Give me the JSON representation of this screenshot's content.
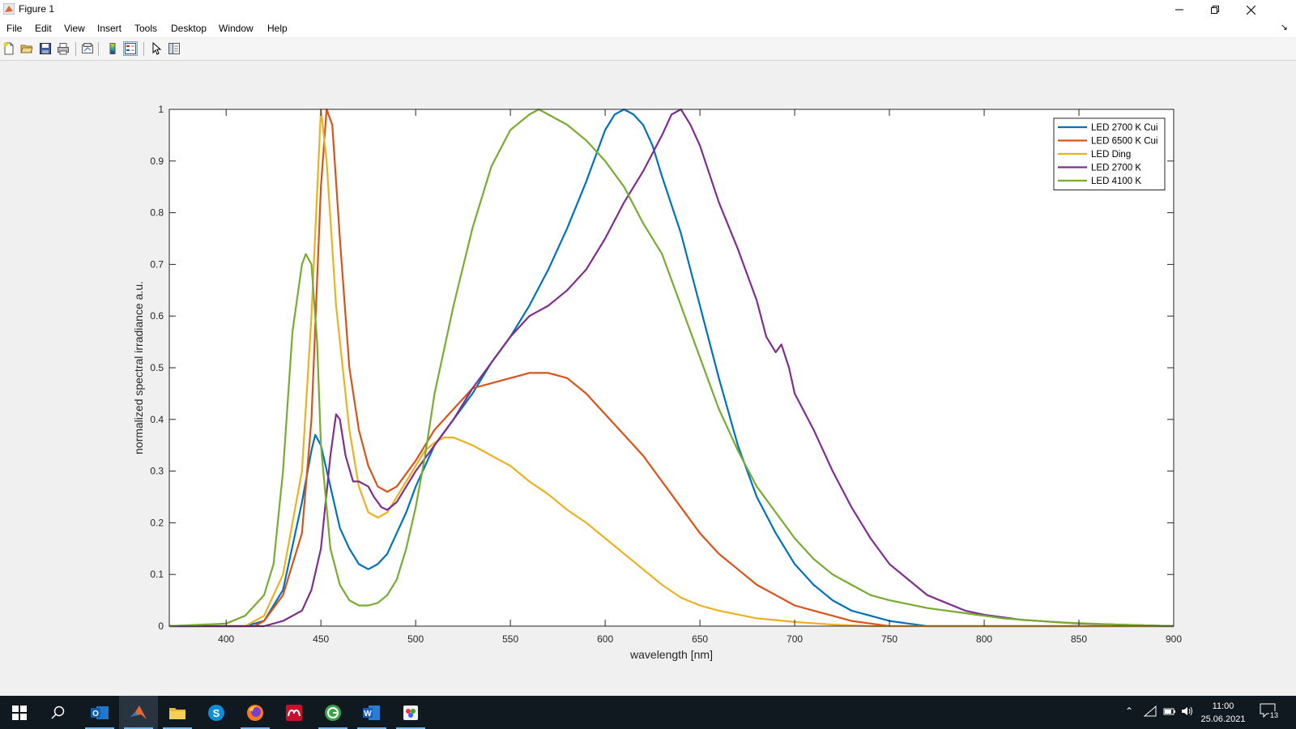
{
  "window": {
    "title": "Figure 1"
  },
  "menu": [
    "File",
    "Edit",
    "View",
    "Insert",
    "Tools",
    "Desktop",
    "Window",
    "Help"
  ],
  "toolbar": {
    "icons": [
      "new-figure-icon",
      "open-file-icon",
      "save-icon",
      "print-icon",
      "link-plot-icon",
      "colorbar-icon",
      "legend-icon",
      "edit-plot-arrow-icon",
      "property-inspector-icon"
    ]
  },
  "chart_data": {
    "type": "line",
    "title": "",
    "xlabel": "wavelength [nm]",
    "ylabel": "normalized spectral irradiance a.u.",
    "xlim": [
      370,
      900
    ],
    "ylim": [
      0,
      1
    ],
    "xticks": [
      400,
      450,
      500,
      550,
      600,
      650,
      700,
      750,
      800,
      850,
      900
    ],
    "yticks": [
      0,
      0.1,
      0.2,
      0.3,
      0.4,
      0.5,
      0.6,
      0.7,
      0.8,
      0.9,
      1
    ],
    "grid": false,
    "legend_position": "top-right",
    "series": [
      {
        "name": "LED 2700 K Cui",
        "color": "#0072BD",
        "points": [
          [
            370,
            0
          ],
          [
            410,
            0
          ],
          [
            420,
            0.01
          ],
          [
            430,
            0.07
          ],
          [
            440,
            0.24
          ],
          [
            445,
            0.34
          ],
          [
            447,
            0.37
          ],
          [
            450,
            0.35
          ],
          [
            455,
            0.27
          ],
          [
            460,
            0.19
          ],
          [
            465,
            0.15
          ],
          [
            470,
            0.12
          ],
          [
            475,
            0.11
          ],
          [
            480,
            0.12
          ],
          [
            485,
            0.14
          ],
          [
            490,
            0.18
          ],
          [
            495,
            0.22
          ],
          [
            500,
            0.27
          ],
          [
            505,
            0.31
          ],
          [
            510,
            0.35
          ],
          [
            520,
            0.4
          ],
          [
            530,
            0.45
          ],
          [
            540,
            0.51
          ],
          [
            550,
            0.56
          ],
          [
            560,
            0.62
          ],
          [
            570,
            0.69
          ],
          [
            580,
            0.77
          ],
          [
            590,
            0.86
          ],
          [
            595,
            0.91
          ],
          [
            600,
            0.96
          ],
          [
            605,
            0.99
          ],
          [
            610,
            1.0
          ],
          [
            615,
            0.99
          ],
          [
            620,
            0.97
          ],
          [
            625,
            0.93
          ],
          [
            630,
            0.87
          ],
          [
            640,
            0.76
          ],
          [
            650,
            0.62
          ],
          [
            660,
            0.48
          ],
          [
            670,
            0.35
          ],
          [
            680,
            0.25
          ],
          [
            690,
            0.18
          ],
          [
            700,
            0.12
          ],
          [
            710,
            0.08
          ],
          [
            720,
            0.05
          ],
          [
            730,
            0.03
          ],
          [
            740,
            0.02
          ],
          [
            750,
            0.01
          ],
          [
            760,
            0.005
          ],
          [
            770,
            0
          ],
          [
            900,
            0
          ]
        ]
      },
      {
        "name": "LED 6500 K Cui",
        "color": "#D95319",
        "points": [
          [
            370,
            0
          ],
          [
            415,
            0
          ],
          [
            420,
            0.01
          ],
          [
            430,
            0.06
          ],
          [
            440,
            0.18
          ],
          [
            445,
            0.4
          ],
          [
            450,
            0.85
          ],
          [
            453,
            1.0
          ],
          [
            456,
            0.97
          ],
          [
            460,
            0.75
          ],
          [
            465,
            0.5
          ],
          [
            470,
            0.38
          ],
          [
            475,
            0.31
          ],
          [
            480,
            0.27
          ],
          [
            485,
            0.26
          ],
          [
            490,
            0.27
          ],
          [
            500,
            0.32
          ],
          [
            510,
            0.38
          ],
          [
            520,
            0.42
          ],
          [
            530,
            0.46
          ],
          [
            540,
            0.47
          ],
          [
            550,
            0.48
          ],
          [
            560,
            0.49
          ],
          [
            570,
            0.49
          ],
          [
            580,
            0.48
          ],
          [
            590,
            0.45
          ],
          [
            600,
            0.41
          ],
          [
            610,
            0.37
          ],
          [
            620,
            0.33
          ],
          [
            630,
            0.28
          ],
          [
            640,
            0.23
          ],
          [
            650,
            0.18
          ],
          [
            660,
            0.14
          ],
          [
            670,
            0.11
          ],
          [
            680,
            0.08
          ],
          [
            690,
            0.06
          ],
          [
            700,
            0.04
          ],
          [
            710,
            0.03
          ],
          [
            720,
            0.02
          ],
          [
            730,
            0.01
          ],
          [
            740,
            0.005
          ],
          [
            750,
            0
          ],
          [
            900,
            0
          ]
        ]
      },
      {
        "name": "LED Ding",
        "color": "#EDB120",
        "points": [
          [
            370,
            0
          ],
          [
            410,
            0
          ],
          [
            420,
            0.02
          ],
          [
            430,
            0.1
          ],
          [
            440,
            0.3
          ],
          [
            445,
            0.6
          ],
          [
            450,
            1.0
          ],
          [
            453,
            0.9
          ],
          [
            458,
            0.62
          ],
          [
            465,
            0.38
          ],
          [
            470,
            0.27
          ],
          [
            475,
            0.22
          ],
          [
            480,
            0.21
          ],
          [
            485,
            0.22
          ],
          [
            490,
            0.25
          ],
          [
            495,
            0.28
          ],
          [
            500,
            0.31
          ],
          [
            505,
            0.34
          ],
          [
            510,
            0.355
          ],
          [
            515,
            0.365
          ],
          [
            520,
            0.365
          ],
          [
            530,
            0.35
          ],
          [
            540,
            0.33
          ],
          [
            550,
            0.31
          ],
          [
            560,
            0.28
          ],
          [
            570,
            0.255
          ],
          [
            580,
            0.225
          ],
          [
            590,
            0.2
          ],
          [
            600,
            0.17
          ],
          [
            610,
            0.14
          ],
          [
            620,
            0.11
          ],
          [
            630,
            0.08
          ],
          [
            640,
            0.055
          ],
          [
            650,
            0.04
          ],
          [
            660,
            0.03
          ],
          [
            680,
            0.015
          ],
          [
            700,
            0.008
          ],
          [
            720,
            0.003
          ],
          [
            740,
            0
          ],
          [
            900,
            0
          ]
        ]
      },
      {
        "name": "LED 2700 K",
        "color": "#7E2F8E",
        "points": [
          [
            370,
            0
          ],
          [
            420,
            0
          ],
          [
            430,
            0.01
          ],
          [
            440,
            0.03
          ],
          [
            445,
            0.07
          ],
          [
            450,
            0.15
          ],
          [
            455,
            0.33
          ],
          [
            458,
            0.41
          ],
          [
            460,
            0.4
          ],
          [
            463,
            0.33
          ],
          [
            467,
            0.28
          ],
          [
            470,
            0.28
          ],
          [
            475,
            0.27
          ],
          [
            478,
            0.25
          ],
          [
            482,
            0.23
          ],
          [
            485,
            0.225
          ],
          [
            490,
            0.24
          ],
          [
            495,
            0.27
          ],
          [
            500,
            0.3
          ],
          [
            510,
            0.35
          ],
          [
            520,
            0.4
          ],
          [
            530,
            0.46
          ],
          [
            540,
            0.51
          ],
          [
            550,
            0.56
          ],
          [
            560,
            0.6
          ],
          [
            570,
            0.62
          ],
          [
            580,
            0.65
          ],
          [
            590,
            0.69
          ],
          [
            600,
            0.75
          ],
          [
            610,
            0.82
          ],
          [
            620,
            0.88
          ],
          [
            630,
            0.95
          ],
          [
            635,
            0.99
          ],
          [
            640,
            1.0
          ],
          [
            645,
            0.97
          ],
          [
            650,
            0.93
          ],
          [
            660,
            0.82
          ],
          [
            670,
            0.73
          ],
          [
            680,
            0.63
          ],
          [
            685,
            0.56
          ],
          [
            690,
            0.53
          ],
          [
            693,
            0.545
          ],
          [
            697,
            0.5
          ],
          [
            700,
            0.45
          ],
          [
            710,
            0.38
          ],
          [
            720,
            0.3
          ],
          [
            730,
            0.23
          ],
          [
            740,
            0.17
          ],
          [
            750,
            0.12
          ],
          [
            760,
            0.09
          ],
          [
            770,
            0.06
          ],
          [
            780,
            0.045
          ],
          [
            790,
            0.03
          ],
          [
            800,
            0.022
          ],
          [
            820,
            0.012
          ],
          [
            850,
            0.005
          ],
          [
            900,
            0
          ]
        ]
      },
      {
        "name": "LED 4100 K",
        "color": "#77AC30",
        "points": [
          [
            370,
            0
          ],
          [
            400,
            0.005
          ],
          [
            410,
            0.02
          ],
          [
            420,
            0.06
          ],
          [
            425,
            0.12
          ],
          [
            430,
            0.3
          ],
          [
            435,
            0.57
          ],
          [
            440,
            0.7
          ],
          [
            442,
            0.72
          ],
          [
            445,
            0.7
          ],
          [
            448,
            0.55
          ],
          [
            450,
            0.35
          ],
          [
            455,
            0.15
          ],
          [
            460,
            0.08
          ],
          [
            465,
            0.05
          ],
          [
            470,
            0.04
          ],
          [
            475,
            0.04
          ],
          [
            480,
            0.045
          ],
          [
            485,
            0.06
          ],
          [
            490,
            0.09
          ],
          [
            495,
            0.15
          ],
          [
            500,
            0.23
          ],
          [
            505,
            0.33
          ],
          [
            510,
            0.45
          ],
          [
            520,
            0.62
          ],
          [
            530,
            0.77
          ],
          [
            540,
            0.89
          ],
          [
            550,
            0.96
          ],
          [
            560,
            0.99
          ],
          [
            565,
            1.0
          ],
          [
            570,
            0.99
          ],
          [
            580,
            0.97
          ],
          [
            590,
            0.94
          ],
          [
            600,
            0.9
          ],
          [
            610,
            0.85
          ],
          [
            620,
            0.78
          ],
          [
            630,
            0.72
          ],
          [
            640,
            0.62
          ],
          [
            650,
            0.52
          ],
          [
            660,
            0.42
          ],
          [
            670,
            0.34
          ],
          [
            680,
            0.27
          ],
          [
            690,
            0.22
          ],
          [
            700,
            0.17
          ],
          [
            710,
            0.13
          ],
          [
            720,
            0.1
          ],
          [
            730,
            0.08
          ],
          [
            740,
            0.06
          ],
          [
            750,
            0.05
          ],
          [
            770,
            0.035
          ],
          [
            790,
            0.025
          ],
          [
            810,
            0.015
          ],
          [
            840,
            0.007
          ],
          [
            870,
            0.003
          ],
          [
            900,
            0
          ]
        ]
      }
    ]
  },
  "taskbar": {
    "apps": [
      "windows-start-icon",
      "search-icon",
      "outlook-icon",
      "matlab-icon",
      "file-explorer-icon",
      "skype-icon",
      "firefox-icon",
      "mendeley-icon",
      "greenshot-icon",
      "word-icon",
      "paint-icon"
    ],
    "time": "11:00",
    "date": "25.06.2021",
    "notifications": "13"
  }
}
